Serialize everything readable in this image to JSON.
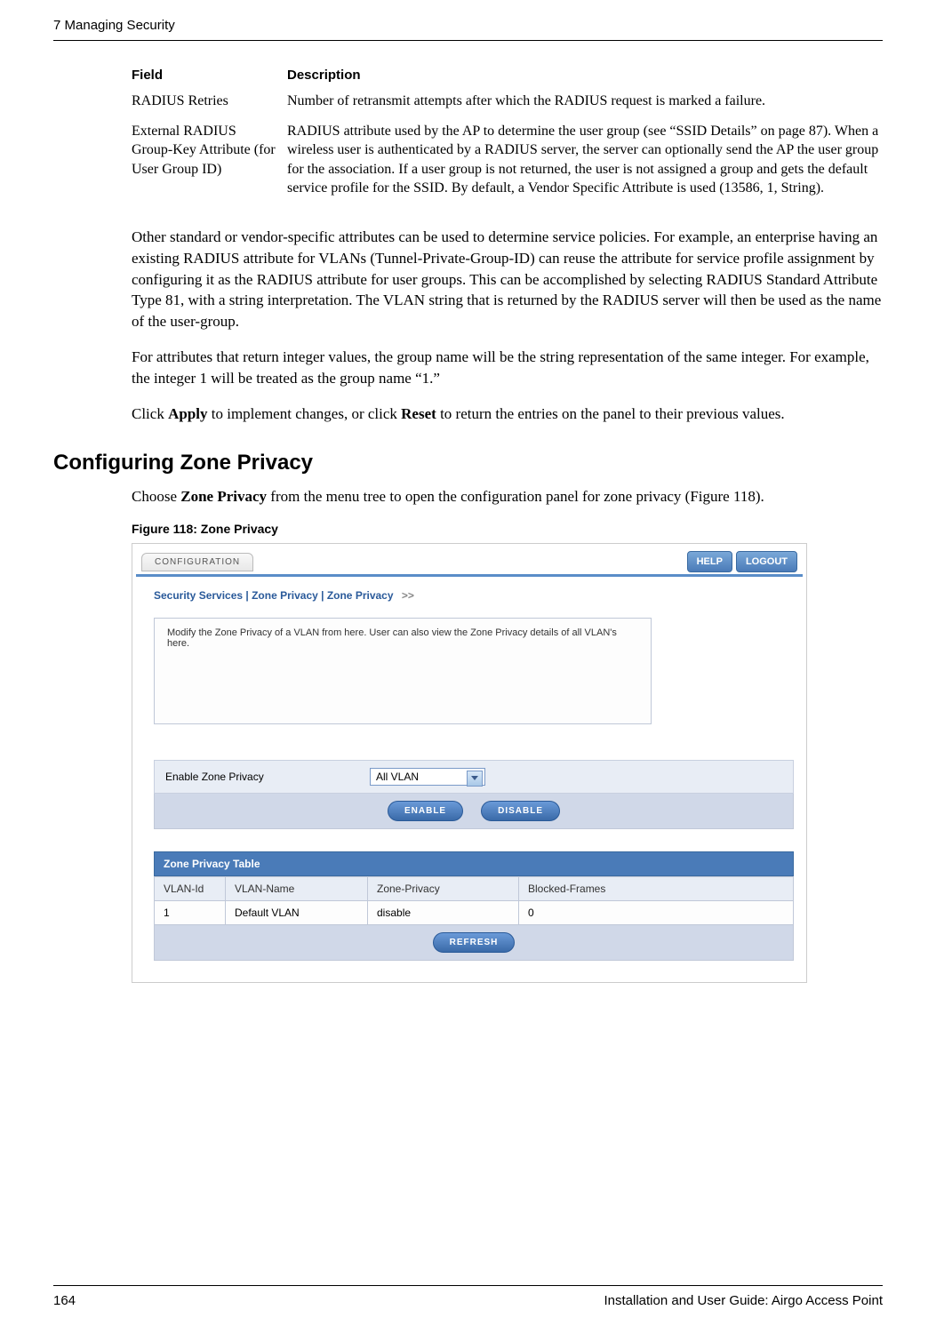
{
  "header": {
    "chapter": "7  Managing Security"
  },
  "table": {
    "headers": {
      "field": "Field",
      "description": "Description"
    },
    "rows": [
      {
        "field": "RADIUS Retries",
        "description": "Number of retransmit attempts after which the RADIUS request is marked a failure."
      },
      {
        "field": "External RADIUS Group-Key Attribute (for User Group ID)",
        "description": "RADIUS attribute used by the AP to determine the user group (see “SSID Details” on page 87). When a wireless user is authenticated by a RADIUS server, the server can optionally send the AP the user group for the association. If a user group is not returned, the user is not assigned a group and gets the default service profile for the SSID. By default, a Vendor Specific Attribute is used (13586, 1, String)."
      }
    ]
  },
  "paragraphs": {
    "p1": "Other standard or vendor-specific attributes can be used to determine service policies. For example, an enterprise having an existing RADIUS attribute for VLANs (Tunnel-Private-Group-ID) can reuse the attribute for service profile assignment by configuring it as the RADIUS attribute for user groups. This can be accomplished by selecting RADIUS Standard Attribute Type 81, with a string interpretation. The VLAN string that is returned by the RADIUS server will then be used as the name of the user-group.",
    "p2": "For attributes that return integer values, the group name will be the string representation of the same integer. For example, the integer 1 will be treated as the group name “1.”",
    "p3_pre": "Click ",
    "p3_apply": "Apply",
    "p3_mid": " to implement changes, or click ",
    "p3_reset": "Reset",
    "p3_post": " to return the entries on the panel to their previous values."
  },
  "section": {
    "heading": "Configuring Zone Privacy",
    "intro_pre": "Choose ",
    "intro_bold": "Zone Privacy",
    "intro_post": " from the menu tree to open the configuration panel for zone privacy (Figure 118).",
    "figure_caption": "Figure 118:    Zone Privacy"
  },
  "screenshot": {
    "config_tab": "CONFIGURATION",
    "help_btn": "HELP",
    "logout_btn": "LOGOUT",
    "breadcrumb": "Security Services  |  Zone Privacy  |  Zone Privacy",
    "breadcrumb_arrow": ">>",
    "info_text": "Modify the Zone Privacy of a VLAN from here. User can also view the Zone Privacy details of all VLAN's here.",
    "enable_label": "Enable Zone Privacy",
    "dropdown_value": "All VLAN",
    "enable_btn": "ENABLE",
    "disable_btn": "DISABLE",
    "table_title": "Zone Privacy Table",
    "columns": {
      "vlan_id": "VLAN-Id",
      "vlan_name": "VLAN-Name",
      "zone_privacy": "Zone-Privacy",
      "blocked_frames": "Blocked-Frames"
    },
    "row": {
      "vlan_id": "1",
      "vlan_name": "Default VLAN",
      "zone_privacy": "disable",
      "blocked_frames": "0"
    },
    "refresh_btn": "REFRESH"
  },
  "footer": {
    "page": "164",
    "title": "Installation and User Guide: Airgo Access Point"
  }
}
